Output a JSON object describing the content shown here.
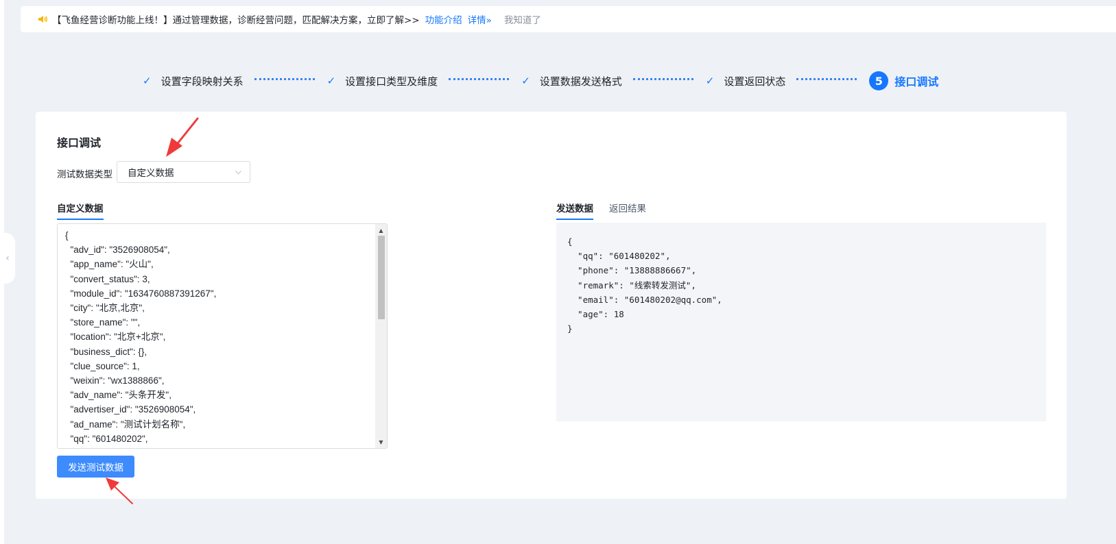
{
  "notice": {
    "text": "【飞鱼经营诊断功能上线！】通过管理数据，诊断经营问题，匹配解决方案，立即了解>>",
    "link_intro": "功能介绍",
    "link_detail": "详情»",
    "dismiss": "我知道了"
  },
  "steps": [
    {
      "label": "设置字段映射关系",
      "status": "done"
    },
    {
      "label": "设置接口类型及维度",
      "status": "done"
    },
    {
      "label": "设置数据发送格式",
      "status": "done"
    },
    {
      "label": "设置返回状态",
      "status": "done"
    },
    {
      "label": "接口调试",
      "status": "active",
      "number": "5"
    }
  ],
  "card": {
    "title": "接口调试",
    "test_type_label": "测试数据类型",
    "test_type_value": "自定义数据",
    "left_tab": "自定义数据",
    "editor_text": "{\n  \"adv_id\": \"3526908054\",\n  \"app_name\": \"火山\",\n  \"convert_status\": 3,\n  \"module_id\": \"1634760887391267\",\n  \"city\": \"北京,北京\",\n  \"store_name\": \"\",\n  \"location\": \"北京+北京\",\n  \"business_dict\": {},\n  \"clue_source\": 1,\n  \"weixin\": \"wx1388866\",\n  \"adv_name\": \"头条开发\",\n  \"advertiser_id\": \"3526908054\",\n  \"ad_name\": \"测试计划名称\",\n  \"qq\": \"601480202\",",
    "send_button": "发送测试数据",
    "right_tabs": [
      {
        "label": "发送数据",
        "active": true
      },
      {
        "label": "返回结果",
        "active": false
      }
    ],
    "result_text": "{\n  \"qq\": \"601480202\",\n  \"phone\": \"13888886667\",\n  \"remark\": \"线索转发测试\",\n  \"email\": \"601480202@qq.com\",\n  \"age\": 18\n}"
  },
  "colors": {
    "accent": "#1677ff",
    "button": "#3d8bfd",
    "annotation_arrow": "#f03a3a"
  }
}
